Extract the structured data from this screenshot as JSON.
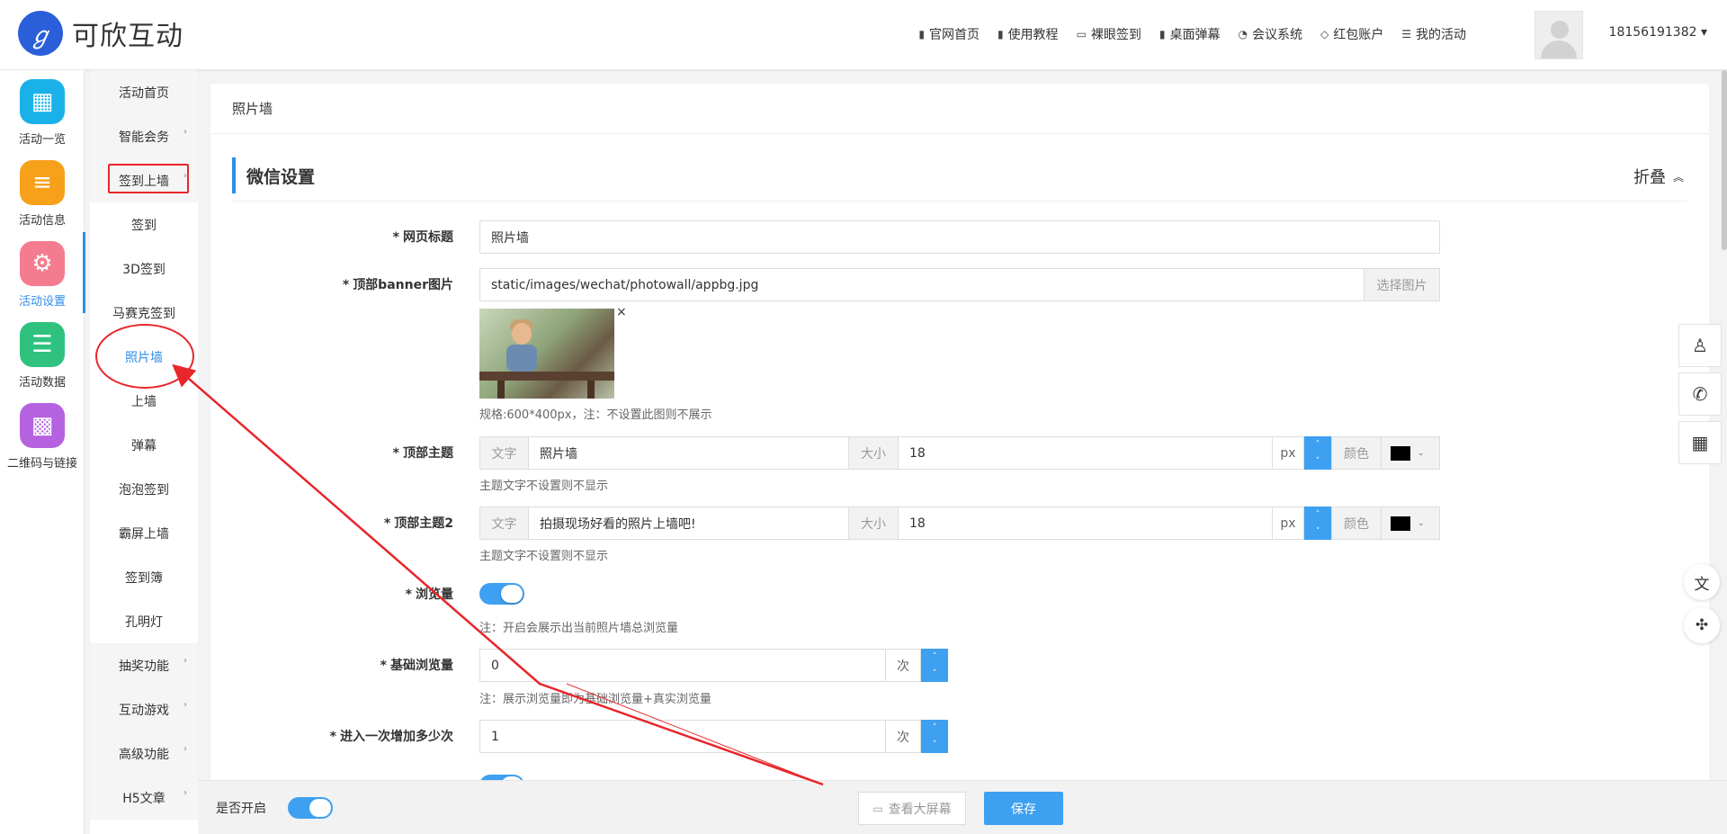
{
  "header": {
    "logo_text": "可欣互动",
    "logo_glyph": "ℊ",
    "nav": [
      {
        "icon": "document-icon",
        "glyph": "▮",
        "label": "官网首页"
      },
      {
        "icon": "document-icon",
        "glyph": "▮",
        "label": "使用教程"
      },
      {
        "icon": "monitor-icon",
        "glyph": "▭",
        "label": "裸眼签到"
      },
      {
        "icon": "document-icon",
        "glyph": "▮",
        "label": "桌面弹幕"
      },
      {
        "icon": "conference-icon",
        "glyph": "◔",
        "label": "会议系统"
      },
      {
        "icon": "diamond-icon",
        "glyph": "◇",
        "label": "红包账户"
      },
      {
        "icon": "list-icon",
        "glyph": "☰",
        "label": "我的活动"
      }
    ],
    "user": "18156191382 ▾"
  },
  "iconbar": [
    {
      "label": "活动一览",
      "icon": "grid-icon",
      "glyph": "▦",
      "color": "#1ab1e8"
    },
    {
      "label": "活动信息",
      "icon": "document-icon",
      "glyph": "≡",
      "color": "#f7a11a"
    },
    {
      "label": "活动设置",
      "icon": "gear-icon",
      "glyph": "⚙",
      "color": "#f47c8e",
      "active": true
    },
    {
      "label": "活动数据",
      "icon": "database-icon",
      "glyph": "☰",
      "color": "#2ec27e"
    },
    {
      "label": "二维码与链接",
      "icon": "qrcode-icon",
      "glyph": "▩",
      "color": "#b562e0"
    }
  ],
  "submenu": [
    {
      "label": "活动首页",
      "type": "group",
      "chev": ""
    },
    {
      "label": "智能会务",
      "type": "group",
      "chev": "›"
    },
    {
      "label": "签到上墙",
      "type": "group",
      "chev": "›"
    },
    {
      "label": "签到",
      "type": "sub",
      "chev": ""
    },
    {
      "label": "3D签到",
      "type": "sub",
      "chev": ""
    },
    {
      "label": "马赛克签到",
      "type": "sub",
      "chev": ""
    },
    {
      "label": "照片墙",
      "type": "sub",
      "chev": "",
      "active": true
    },
    {
      "label": "上墙",
      "type": "sub",
      "chev": ""
    },
    {
      "label": "弹幕",
      "type": "sub",
      "chev": ""
    },
    {
      "label": "泡泡签到",
      "type": "sub",
      "chev": ""
    },
    {
      "label": "霸屏上墙",
      "type": "sub",
      "chev": ""
    },
    {
      "label": "签到簿",
      "type": "sub",
      "chev": ""
    },
    {
      "label": "孔明灯",
      "type": "sub",
      "chev": ""
    },
    {
      "label": "抽奖功能",
      "type": "group",
      "chev": "›"
    },
    {
      "label": "互动游戏",
      "type": "group",
      "chev": "›"
    },
    {
      "label": "高级功能",
      "type": "group",
      "chev": "›"
    },
    {
      "label": "H5文章",
      "type": "group",
      "chev": "›"
    }
  ],
  "content": {
    "breadcrumb": "照片墙",
    "section_title": "微信设置",
    "fold_label": "折叠",
    "fold_glyph": "︽",
    "page_title": {
      "label": "网页标题",
      "value": "照片墙"
    },
    "banner": {
      "label": "顶部banner图片",
      "value": "static/images/wechat/photowall/appbg.jpg",
      "button": "选择图片",
      "close": "×",
      "hint": "规格:600*400px，注：不设置此图则不展示"
    },
    "theme1": {
      "label": "顶部主题",
      "text_addon": "文字",
      "text": "照片墙",
      "size_addon": "大小",
      "size": "18",
      "unit": "px",
      "color_addon": "颜色",
      "hint": "主题文字不设置则不显示"
    },
    "theme2": {
      "label": "顶部主题2",
      "text_addon": "文字",
      "text": "拍摄现场好看的照片上墙吧!",
      "size_addon": "大小",
      "size": "18",
      "unit": "px",
      "color_addon": "颜色",
      "hint": "主题文字不设置则不显示"
    },
    "views": {
      "label": "浏览量",
      "hint": "注：开启会展示出当前照片墙总浏览量"
    },
    "base_views": {
      "label": "基础浏览量",
      "value": "0",
      "unit": "次",
      "hint": "注：展示浏览量即为基础浏览量+真实浏览量"
    },
    "increment": {
      "label": "进入一次增加多少次",
      "value": "1",
      "unit": "次"
    },
    "required_mark": "*",
    "spinner_up": "˄",
    "spinner_down": "˅",
    "color_caret": "⌄"
  },
  "bottom": {
    "enable_label": "是否开启",
    "screen_button": "查看大屏幕",
    "screen_glyph": "▭",
    "save_button": "保存"
  },
  "floats": [
    {
      "icon": "qq-icon",
      "glyph": "♙"
    },
    {
      "icon": "phone-icon",
      "glyph": "✆"
    },
    {
      "icon": "qrcode-icon",
      "glyph": "▦"
    }
  ],
  "float_round": [
    {
      "icon": "translate-icon",
      "glyph": "文"
    },
    {
      "icon": "network-icon",
      "glyph": "✣"
    }
  ],
  "colors": {
    "accent": "#3ea0f0",
    "annotation": "#e8262b"
  }
}
